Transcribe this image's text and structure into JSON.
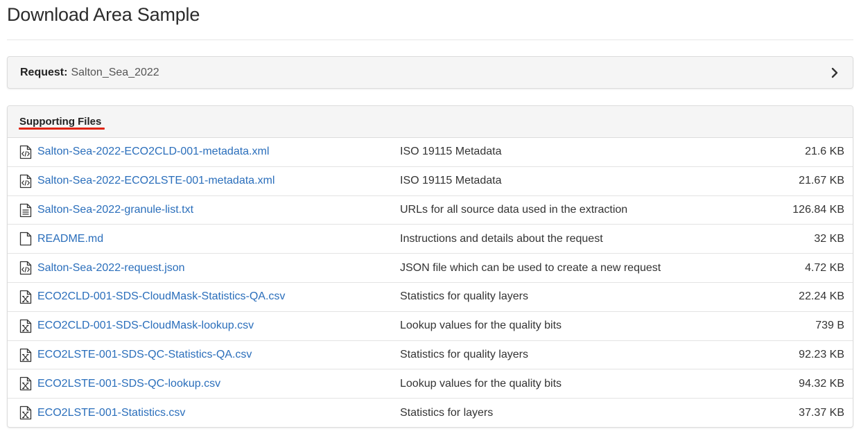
{
  "page": {
    "title": "Download Area Sample"
  },
  "request": {
    "label": "Request:",
    "value": "Salton_Sea_2022"
  },
  "supporting": {
    "heading": "Supporting Files",
    "accent_color": "#e02514",
    "link_color": "#2a6ebb",
    "files": [
      {
        "icon": "file-code-icon",
        "name": "Salton-Sea-2022-ECO2CLD-001-metadata.xml",
        "description": "ISO 19115 Metadata",
        "size": "21.6 KB"
      },
      {
        "icon": "file-code-icon",
        "name": "Salton-Sea-2022-ECO2LSTE-001-metadata.xml",
        "description": "ISO 19115 Metadata",
        "size": "21.67 KB"
      },
      {
        "icon": "file-text-icon",
        "name": "Salton-Sea-2022-granule-list.txt",
        "description": "URLs for all source data used in the extraction",
        "size": "126.84 KB"
      },
      {
        "icon": "file-blank-icon",
        "name": "README.md",
        "description": "Instructions and details about the request",
        "size": "32 KB"
      },
      {
        "icon": "file-code-icon",
        "name": "Salton-Sea-2022-request.json",
        "description": "JSON file which can be used to create a new request",
        "size": "4.72 KB"
      },
      {
        "icon": "file-excel-icon",
        "name": "ECO2CLD-001-SDS-CloudMask-Statistics-QA.csv",
        "description": "Statistics for quality layers",
        "size": "22.24 KB"
      },
      {
        "icon": "file-excel-icon",
        "name": "ECO2CLD-001-SDS-CloudMask-lookup.csv",
        "description": "Lookup values for the quality bits",
        "size": "739 B"
      },
      {
        "icon": "file-excel-icon",
        "name": "ECO2LSTE-001-SDS-QC-Statistics-QA.csv",
        "description": "Statistics for quality layers",
        "size": "92.23 KB"
      },
      {
        "icon": "file-excel-icon",
        "name": "ECO2LSTE-001-SDS-QC-lookup.csv",
        "description": "Lookup values for the quality bits",
        "size": "94.32 KB"
      },
      {
        "icon": "file-excel-icon",
        "name": "ECO2LSTE-001-Statistics.csv",
        "description": "Statistics for layers",
        "size": "37.37 KB"
      }
    ]
  }
}
